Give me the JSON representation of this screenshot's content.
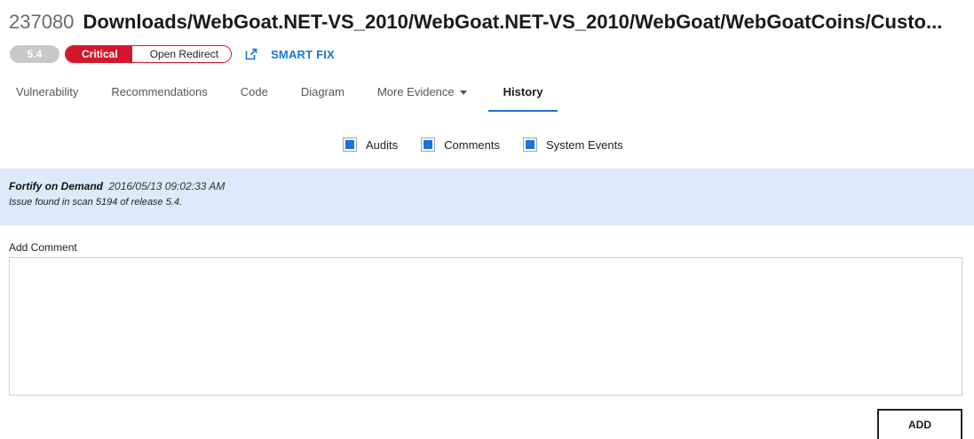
{
  "header": {
    "issue_id": "237080",
    "path": "Downloads/WebGoat.NET-VS_2010/WebGoat.NET-VS_2010/WebGoat/WebGoatCoins/Custo..."
  },
  "badges": {
    "score": "5.4",
    "severity": "Critical",
    "category": "Open Redirect",
    "smart_fix": "SMART FIX",
    "severity_color": "#d4152a",
    "link_color": "#1a74d8"
  },
  "tabs": [
    {
      "label": "Vulnerability"
    },
    {
      "label": "Recommendations"
    },
    {
      "label": "Code"
    },
    {
      "label": "Diagram"
    },
    {
      "label": "More Evidence"
    },
    {
      "label": "History",
      "active": true
    }
  ],
  "filters": [
    {
      "label": "Audits",
      "checked": true
    },
    {
      "label": "Comments",
      "checked": true
    },
    {
      "label": "System Events",
      "checked": true
    }
  ],
  "event": {
    "author": "Fortify on Demand",
    "timestamp": "2016/05/13 09:02:33 AM",
    "message": "Issue found in scan 5194 of release 5.4.",
    "background": "#dcebfa"
  },
  "comment": {
    "label": "Add Comment",
    "value": ""
  },
  "actions": {
    "add_label": "ADD"
  }
}
